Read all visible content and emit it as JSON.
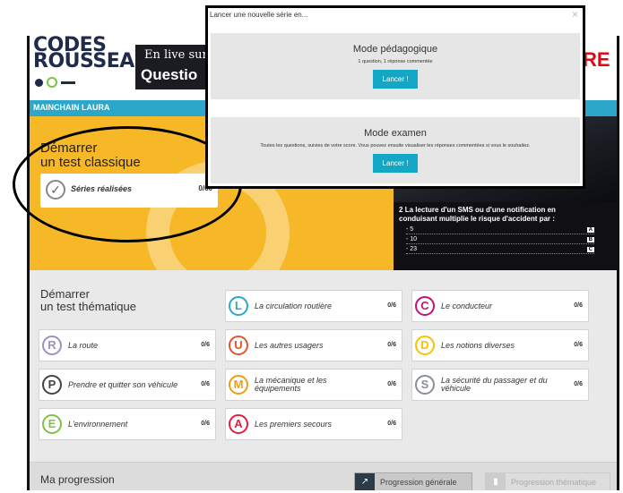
{
  "header": {
    "logo_line1": "CODES",
    "logo_line2": "ROUSSEAU",
    "banner_line1": "En live sur l",
    "banner_line2": "Questio",
    "brand_right": "RE"
  },
  "user": {
    "name": "MAINCHAIN LAURA"
  },
  "classic": {
    "title_line1": "Démarrer",
    "title_line2": "un test classique",
    "series_label": "Séries réalisées",
    "series_count": "0/60"
  },
  "video": {
    "question_number": "2",
    "question_text": "La lecture d'un SMS ou d'une notification en conduisant multiplie le risque d'accident par :",
    "answers": [
      {
        "text": "- 5",
        "letter": "A"
      },
      {
        "text": "- 10",
        "letter": "B"
      },
      {
        "text": "- 23",
        "letter": "C"
      }
    ]
  },
  "thematic": {
    "title_line1": "Démarrer",
    "title_line2": "un test thématique",
    "cards": [
      {
        "letter": "L",
        "label": "La circulation routière",
        "count": "0/6",
        "color": "#2aa7c9"
      },
      {
        "letter": "C",
        "label": "Le conducteur",
        "count": "0/6",
        "color": "#c0127e"
      },
      {
        "letter": "R",
        "label": "La route",
        "count": "0/6",
        "color": "#9b8fc8"
      },
      {
        "letter": "U",
        "label": "Les autres usagers",
        "count": "0/6",
        "color": "#e5532f"
      },
      {
        "letter": "D",
        "label": "Les notions diverses",
        "count": "0/6",
        "color": "#f6c300"
      },
      {
        "letter": "P",
        "label": "Prendre et quitter son véhicule",
        "count": "0/6",
        "color": "#444444"
      },
      {
        "letter": "M",
        "label": "La mécanique et les équipements",
        "count": "0/6",
        "color": "#f39c12"
      },
      {
        "letter": "S",
        "label": "La sécurité du passager et du véhicule",
        "count": "0/6",
        "color": "#8a8f97"
      },
      {
        "letter": "E",
        "label": "L'environnement",
        "count": "0/6",
        "color": "#7fc242"
      },
      {
        "letter": "A",
        "label": "Les premiers secours",
        "count": "0/6",
        "color": "#e41f3b"
      }
    ]
  },
  "progress": {
    "title": "Ma progression",
    "tab_general": "Progression générale",
    "tab_thematic": "Progression thématique"
  },
  "modal": {
    "header": "Lancer une nouvelle série en...",
    "close": "×",
    "ped_title": "Mode pédagogique",
    "ped_desc": "1 question, 1 réponse commentée",
    "ped_button": "Lancer !",
    "exam_title": "Mode examen",
    "exam_desc": "Toutes les questions, suivies de votre score. Vous pouvez ensuite visualiser les réponses commentées si vous le souhaitez.",
    "exam_button": "Lancer !"
  }
}
